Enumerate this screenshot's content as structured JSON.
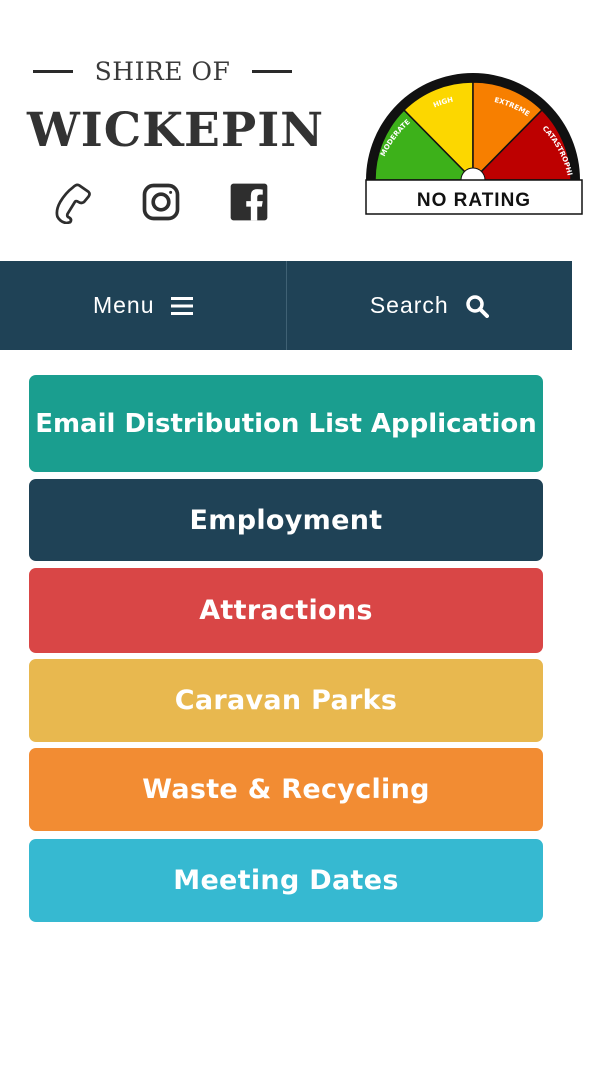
{
  "header": {
    "shire_of": "SHIRE OF",
    "council_name": "WICKEPIN",
    "social": [
      {
        "name": "phone",
        "icon": "phone-icon"
      },
      {
        "name": "instagram",
        "icon": "instagram-icon"
      },
      {
        "name": "facebook",
        "icon": "facebook-icon"
      }
    ]
  },
  "fire_danger": {
    "segments": [
      {
        "label": "MODERATE",
        "color": "#3db11a"
      },
      {
        "label": "HIGH",
        "color": "#fcd700"
      },
      {
        "label": "EXTREME",
        "color": "#f77f00"
      },
      {
        "label": "CATASTROPHIC",
        "color": "#bd0000"
      }
    ],
    "rating": "NO RATING"
  },
  "nav": {
    "menu_label": "Menu",
    "search_label": "Search",
    "menu_icon": "hamburger-icon",
    "search_icon": "search-icon",
    "background": "#1f4256"
  },
  "quick_links": [
    {
      "label": "Email Distribution List Application",
      "color": "#1a9e8f"
    },
    {
      "label": "Employment",
      "color": "#1f4256"
    },
    {
      "label": "Attractions",
      "color": "#d94646"
    },
    {
      "label": "Caravan Parks",
      "color": "#e8b84f"
    },
    {
      "label": "Waste & Recycling",
      "color": "#f28c33"
    },
    {
      "label": "Meeting Dates",
      "color": "#36b9d1"
    }
  ]
}
